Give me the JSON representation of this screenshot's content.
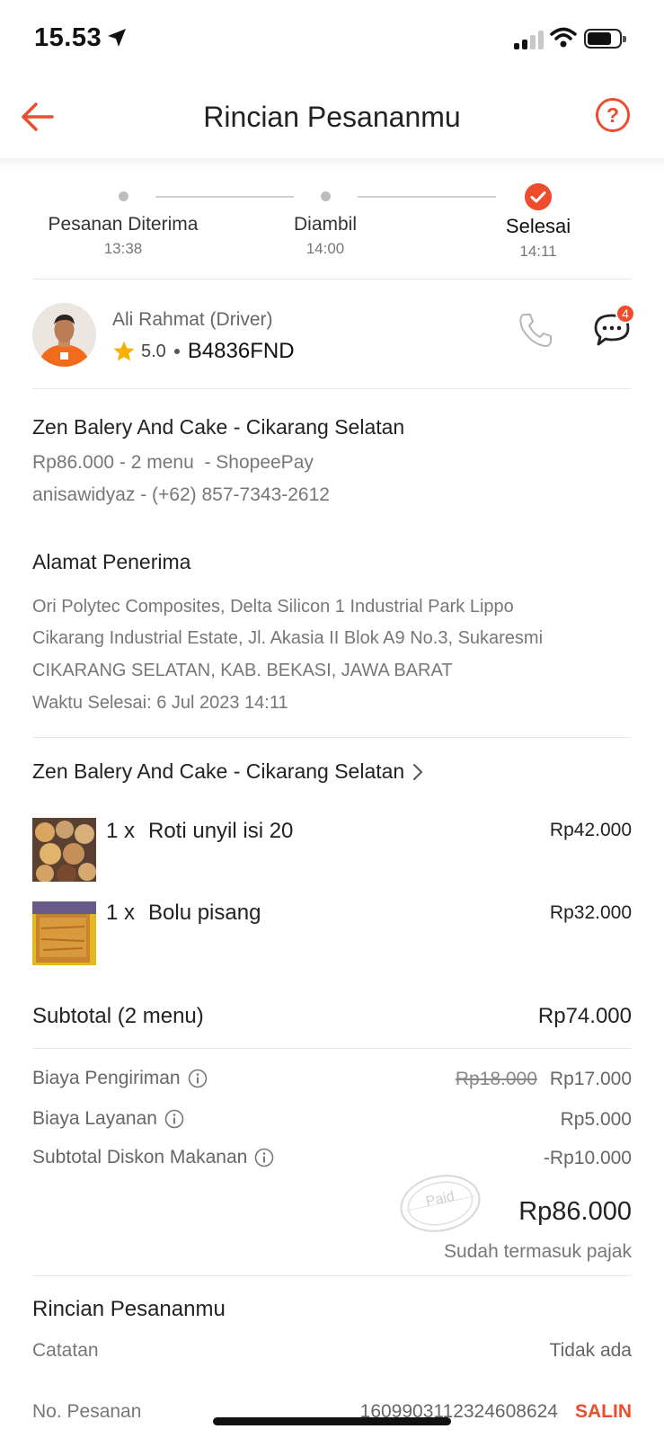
{
  "status_bar": {
    "time": "15.53"
  },
  "header": {
    "title": "Rincian Pesananmu",
    "help_label": "?"
  },
  "progress": {
    "steps": [
      {
        "label": "Pesanan Diterima",
        "time": "13:38",
        "status": "done"
      },
      {
        "label": "Diambil",
        "time": "14:00",
        "status": "done"
      },
      {
        "label": "Selesai",
        "time": "14:11",
        "status": "current"
      }
    ]
  },
  "driver": {
    "name": "Ali Rahmat (Driver)",
    "rating": "5.0",
    "plate": "B4836FND",
    "chat_badge": "4"
  },
  "order_summary": {
    "store": "Zen Balery And Cake - Cikarang Selatan",
    "info": "Rp86.000 - 2 menu  - ShopeePay",
    "contact": "anisawidyaz - (+62) 857-7343-2612"
  },
  "address": {
    "heading": "Alamat Penerima",
    "line1": "Ori Polytec Composites, Delta Silicon 1 Industrial Park Lippo",
    "line2": "Cikarang Industrial Estate, Jl. Akasia II Blok A9 No.3, Sukaresmi",
    "line3": "CIKARANG SELATAN, KAB. BEKASI, JAWA BARAT",
    "completed": "Waktu Selesai: 6 Jul 2023 14:11"
  },
  "store_link": "Zen Balery And Cake - Cikarang Selatan",
  "items": [
    {
      "qty": "1 x",
      "name": "Roti unyil isi 20",
      "price": "Rp42.000"
    },
    {
      "qty": "1 x",
      "name": "Bolu pisang",
      "price": "Rp32.000"
    }
  ],
  "subtotal": {
    "label": "Subtotal (2 menu)",
    "value": "Rp74.000"
  },
  "fees": {
    "delivery_label": "Biaya Pengiriman",
    "delivery_old": "Rp18.000",
    "delivery_value": "Rp17.000",
    "service_label": "Biaya Layanan",
    "service_value": "Rp5.000",
    "discount_label": "Subtotal Diskon Makanan",
    "discount_value": "-Rp10.000"
  },
  "total": {
    "value": "Rp86.000",
    "note": "Sudah termasuk pajak",
    "stamp": "Paid"
  },
  "details": {
    "heading": "Rincian Pesananmu",
    "note_label": "Catatan",
    "note_value": "Tidak ada",
    "order_no_label": "No. Pesanan",
    "order_no_value": "1609903112324608624",
    "copy_label": "SALIN"
  },
  "colors": {
    "accent": "#ee4d2d",
    "star": "#f6b100"
  }
}
